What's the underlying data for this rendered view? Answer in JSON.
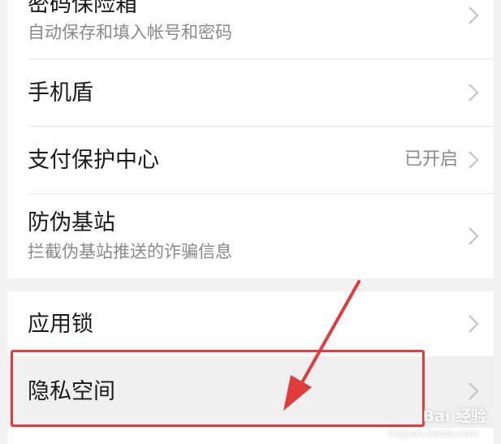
{
  "settings": {
    "password_vault": {
      "title": "密码保险箱",
      "subtitle": "自动保存和填入帐号和密码"
    },
    "phone_shield": {
      "title": "手机盾"
    },
    "payment_protection": {
      "title": "支付保护中心",
      "status": "已开启"
    },
    "fake_base_station": {
      "title": "防伪基站",
      "subtitle": "拦截伪基站推送的诈骗信息"
    },
    "app_lock": {
      "title": "应用锁"
    },
    "private_space": {
      "title": "隐私空间"
    }
  },
  "annotation": {
    "color": "#e03c3c"
  },
  "watermark": {
    "brand": "Bai 经验",
    "url": "jingyan.baidu.com"
  }
}
